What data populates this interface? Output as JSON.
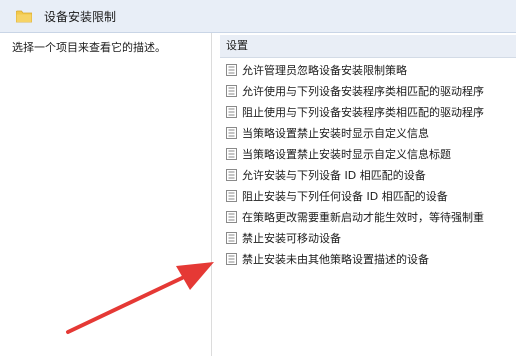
{
  "header": {
    "title": "设备安装限制",
    "icon": "folder-icon"
  },
  "left_pane": {
    "description": "选择一个项目来查看它的描述。"
  },
  "right_pane": {
    "column_header": "设置",
    "items": [
      {
        "label": "允许管理员忽略设备安装限制策略"
      },
      {
        "label": "允许使用与下列设备安装程序类相匹配的驱动程序"
      },
      {
        "label": "阻止使用与下列设备安装程序类相匹配的驱动程序"
      },
      {
        "label": "当策略设置禁止安装时显示自定义信息"
      },
      {
        "label": "当策略设置禁止安装时显示自定义信息标题"
      },
      {
        "label": "允许安装与下列设备 ID 相匹配的设备"
      },
      {
        "label": "阻止安装与下列任何设备 ID 相匹配的设备"
      },
      {
        "label": "在策略更改需要重新启动才能生效时，等待强制重"
      },
      {
        "label": "禁止安装可移动设备"
      },
      {
        "label": "禁止安装未由其他策略设置描述的设备"
      }
    ]
  },
  "annotation": {
    "arrow_color": "#e53935",
    "icon": "red-arrow-icon"
  }
}
